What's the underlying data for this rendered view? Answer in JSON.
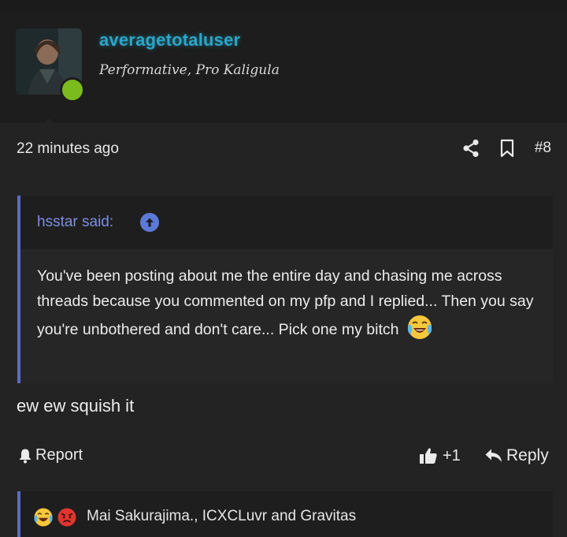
{
  "post": {
    "author": {
      "username": "averagetotaluser",
      "title": "Performative, Pro Kaligula",
      "avatar_icon": "avatar-image",
      "status_color": "#7cbb1d",
      "username_color": "#2aa6c8"
    },
    "time": "22 minutes ago",
    "number": "#8",
    "icons": {
      "share": "share-icon",
      "bookmark": "bookmark-icon"
    },
    "quote": {
      "author_label": "hsstar said:",
      "text": "You've been posting about me the entire day and chasing me across threads because you commented on my pfp and I replied... Then you say you're unbothered and don't care... Pick one my bitch",
      "emoji": "crying-laughing-emoji",
      "accent_color": "#5b6cc4"
    },
    "message": "ew ew squish it",
    "actions": {
      "report_label": "Report",
      "like_count": "+1",
      "reply_label": "Reply"
    },
    "reactions": {
      "icons": [
        "crying-laughing-emoji",
        "angry-emoji"
      ],
      "names": "Mai Sakurajima., ICXCLuvr and Gravitas"
    }
  }
}
